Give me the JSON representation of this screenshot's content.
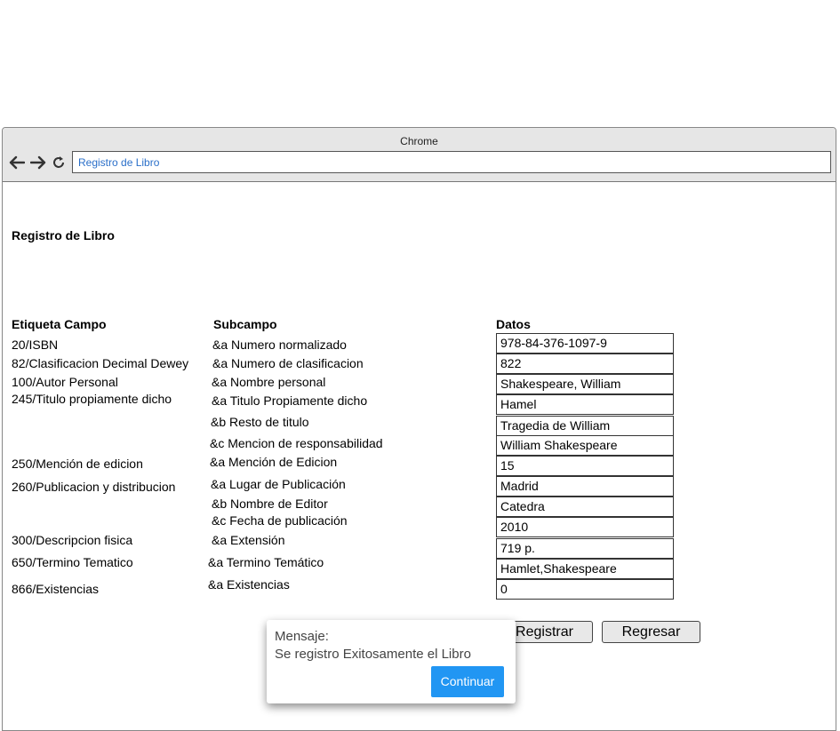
{
  "browser": {
    "title": "Chrome",
    "address": "Registro de Libro",
    "back_icon": "arrow-left-icon",
    "forward_icon": "arrow-right-icon",
    "reload_icon": "reload-icon"
  },
  "page": {
    "title": "Registro de Libro",
    "headers": {
      "campo": "Etiqueta Campo",
      "subcampo": "Subcampo",
      "datos": "Datos"
    },
    "campos": [
      "20/ISBN",
      "82/Clasificacion Decimal Dewey",
      "100/Autor Personal",
      "245/Titulo propiamente dicho",
      "250/Mención de edicion",
      "260/Publicacion y distribucion",
      "300/Descripcion fisica",
      "650/Termino Tematico",
      "866/Existencias"
    ],
    "subcampos": [
      "&a Numero normalizado",
      "&a Numero de clasificacion",
      "&a Nombre personal",
      "&a Titulo Propiamente dicho",
      "&b Resto de titulo",
      "&c Mencion de responsabilidad",
      "&a Mención de Edicion",
      "&a Lugar de Publicación",
      "&b Nombre de Editor",
      "&c Fecha de publicación",
      "&a Extensión",
      "&a Termino Temático",
      "&a Existencias"
    ],
    "datos": [
      "978-84-376-1097-9",
      "822",
      "Shakespeare, William",
      "Hamel",
      "Tragedia de William",
      "William Shakespeare",
      "15",
      "Madrid",
      "Catedra",
      "2010",
      "719 p.",
      " Hamlet,Shakespeare",
      "0"
    ],
    "buttons": {
      "registrar": "Registrar",
      "regresar": "Regresar"
    }
  },
  "dialog": {
    "title": "Mensaje:",
    "message": "Se registro Exitosamente el Libro",
    "button": "Continuar",
    "accent_color": "#2196f3"
  }
}
